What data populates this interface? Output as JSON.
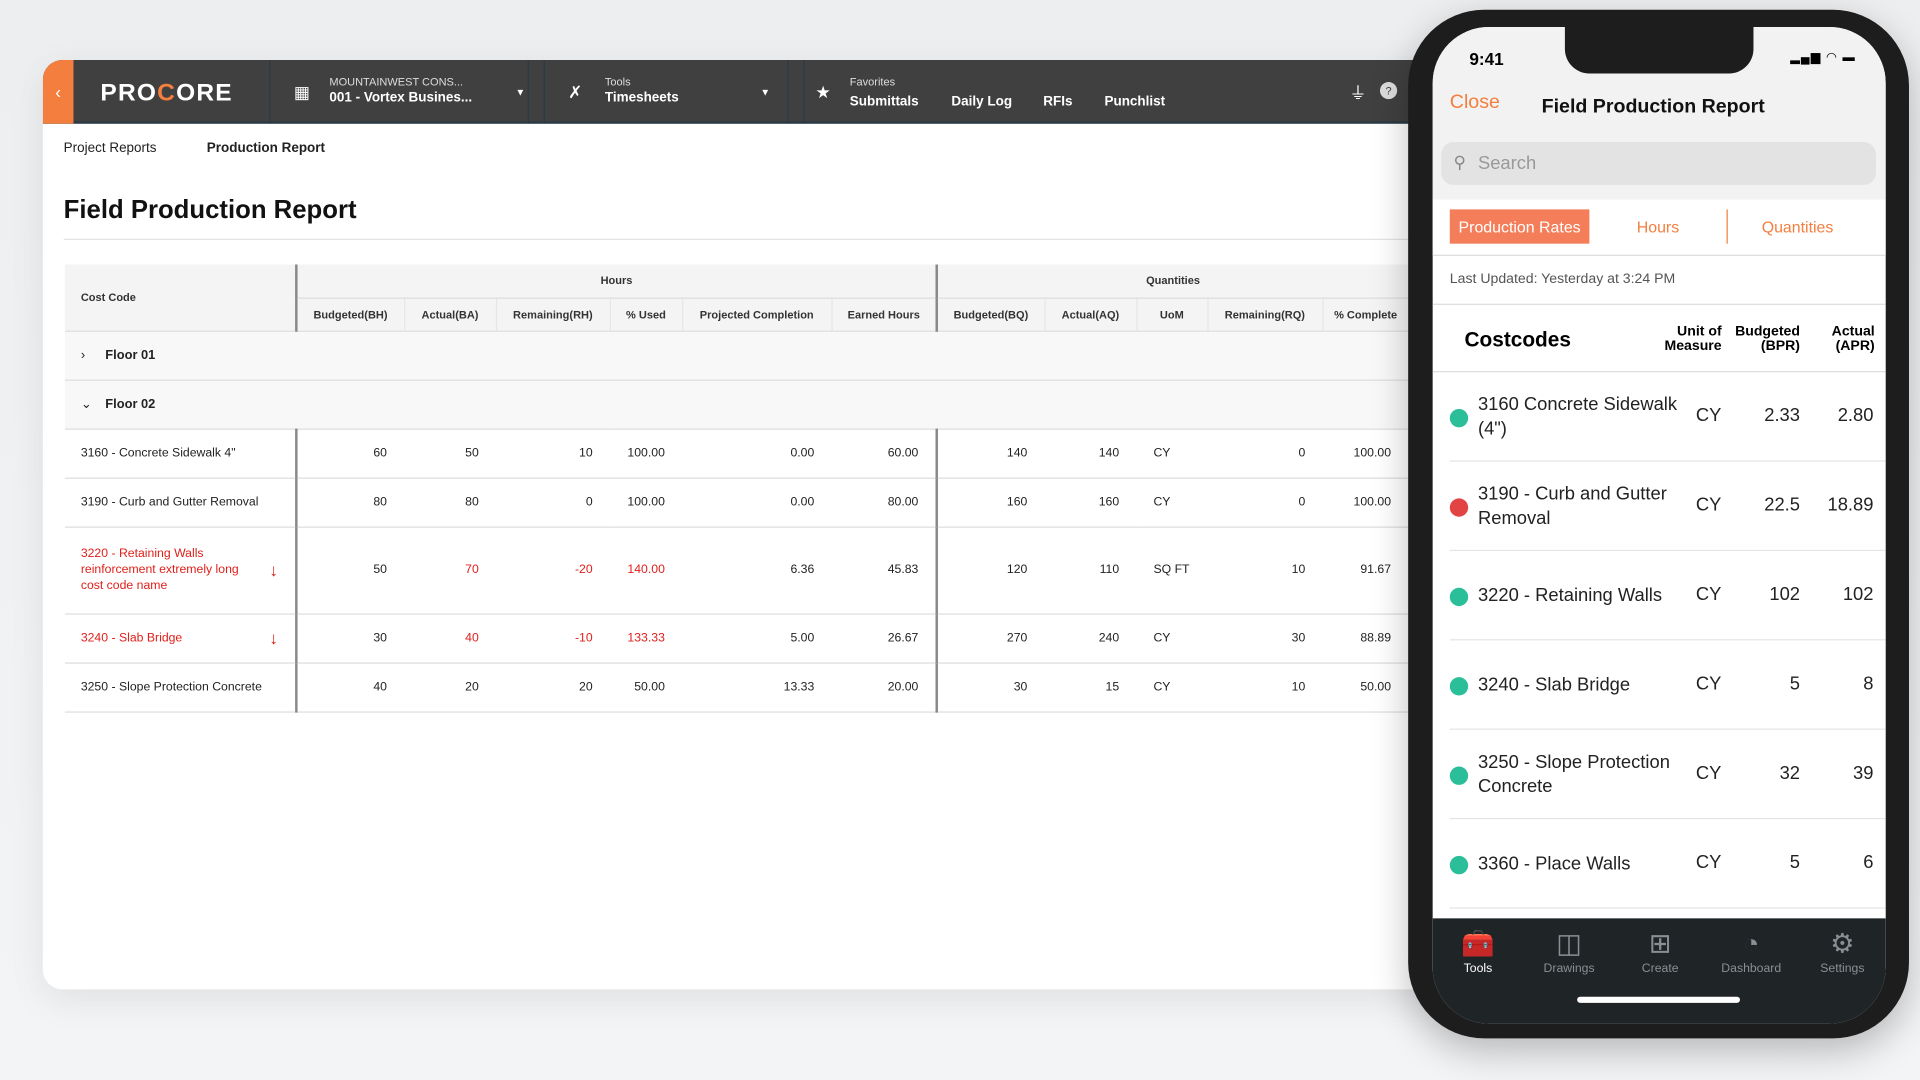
{
  "nav": {
    "logo": "PROCORE",
    "company": "MOUNTAINWEST CONS...",
    "project": "001 - Vortex Busines...",
    "tools_label": "Tools",
    "tool": "Timesheets",
    "favorites_label": "Favorites",
    "favorites": [
      "Submittals",
      "Daily Log",
      "RFIs",
      "Punchlist"
    ]
  },
  "breadcrumbs": [
    "Project Reports",
    "Production Report"
  ],
  "page_title": "Field Production Report",
  "table": {
    "cost_code_header": "Cost Code",
    "hours_group": "Hours",
    "quantities_group": "Quantities",
    "columns": [
      "Budgeted(BH)",
      "Actual(BA)",
      "Remaining(RH)",
      "% Used",
      "Projected Completion",
      "Earned Hours",
      "Budgeted(BQ)",
      "Actual(AQ)",
      "UoM",
      "Remaining(RQ)",
      "% Complete"
    ],
    "groups": [
      {
        "label": "Floor 01",
        "expanded": false
      },
      {
        "label": "Floor 02",
        "expanded": true
      }
    ],
    "rows": [
      {
        "code": "3160 - Concrete Sidewalk 4\"",
        "over": false,
        "v": [
          "60",
          "50",
          "10",
          "100.00",
          "0.00",
          "60.00",
          "140",
          "140",
          "CY",
          "0",
          "100.00"
        ]
      },
      {
        "code": "3190 - Curb and Gutter Removal",
        "over": false,
        "v": [
          "80",
          "80",
          "0",
          "100.00",
          "0.00",
          "80.00",
          "160",
          "160",
          "CY",
          "0",
          "100.00"
        ]
      },
      {
        "code": "3220 - Retaining Walls reinforcement extremely long cost code name",
        "over": true,
        "v": [
          "50",
          "70",
          "-20",
          "140.00",
          "6.36",
          "45.83",
          "120",
          "110",
          "SQ FT",
          "10",
          "91.67"
        ]
      },
      {
        "code": "3240 - Slab Bridge",
        "over": true,
        "v": [
          "30",
          "40",
          "-10",
          "133.33",
          "5.00",
          "26.67",
          "270",
          "240",
          "CY",
          "30",
          "88.89"
        ]
      },
      {
        "code": "3250 - Slope Protection Concrete",
        "over": false,
        "v": [
          "40",
          "20",
          "20",
          "50.00",
          "13.33",
          "20.00",
          "30",
          "15",
          "CY",
          "10",
          "50.00"
        ]
      }
    ]
  },
  "mobile": {
    "time": "9:41",
    "close": "Close",
    "title": "Field Production Report",
    "search_placeholder": "Search",
    "tabs": [
      "Production Rates",
      "Hours",
      "Quantities"
    ],
    "active_tab": "Production Rates",
    "last_updated": "Last Updated: Yesterday at 3:24 PM",
    "headers": {
      "costcodes": "Costcodes",
      "uom": "Unit of Measure",
      "budgeted": "Budgeted (BPR)",
      "actual": "Actual (APR)"
    },
    "rows": [
      {
        "name": "3160 Concrete Sidewalk (4\")",
        "status": "good",
        "uom": "CY",
        "budgeted": "2.33",
        "actual": "2.80"
      },
      {
        "name": "3190 - Curb and Gutter Removal",
        "status": "bad",
        "uom": "CY",
        "budgeted": "22.5",
        "actual": "18.89"
      },
      {
        "name": "3220 - Retaining Walls",
        "status": "good",
        "uom": "CY",
        "budgeted": "102",
        "actual": "102"
      },
      {
        "name": "3240 - Slab Bridge",
        "status": "good",
        "uom": "CY",
        "budgeted": "5",
        "actual": "8"
      },
      {
        "name": "3250 - Slope Protection Concrete",
        "status": "good",
        "uom": "CY",
        "budgeted": "32",
        "actual": "39"
      },
      {
        "name": "3360 - Place Walls",
        "status": "good",
        "uom": "CY",
        "budgeted": "5",
        "actual": "6"
      }
    ],
    "tabbar": [
      {
        "label": "Tools",
        "icon": "toolbox-icon",
        "active": true
      },
      {
        "label": "Drawings",
        "icon": "floorplan-icon"
      },
      {
        "label": "Create",
        "icon": "plus-icon"
      },
      {
        "label": "Dashboard",
        "icon": "gauge-icon"
      },
      {
        "label": "Settings",
        "icon": "gear-icon"
      }
    ]
  },
  "colors": {
    "accent": "#f47e3e",
    "good": "#2bbf99",
    "bad": "#e24444",
    "over": "#e0201b",
    "nav": "#404040"
  }
}
